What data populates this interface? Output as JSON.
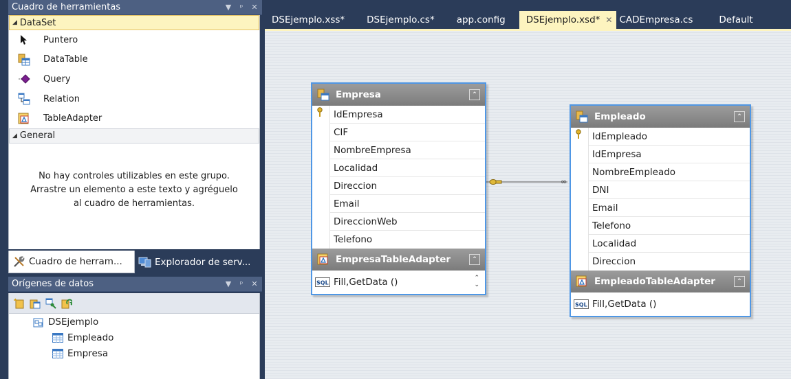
{
  "toolbox": {
    "title": "Cuadro de herramientas",
    "dataset_group": "DataSet",
    "items": [
      {
        "label": "Puntero"
      },
      {
        "label": "DataTable"
      },
      {
        "label": "Query"
      },
      {
        "label": "Relation"
      },
      {
        "label": "TableAdapter"
      }
    ],
    "general_group": "General",
    "empty_message_line1": "No hay controles utilizables en este grupo.",
    "empty_message_line2": "Arrastre un elemento a este texto y agréguelo",
    "empty_message_line3": "al cuadro de herramientas."
  },
  "bottom_tabs": {
    "toolbox": "Cuadro de herram...",
    "server_explorer": "Explorador de serv..."
  },
  "datasources": {
    "title": "Orígenes de datos",
    "root": "DSEjemplo",
    "tables": [
      "Empleado",
      "Empresa"
    ]
  },
  "doc_tabs": [
    {
      "label": "DSEjemplo.xss*"
    },
    {
      "label": "DSEjemplo.cs*"
    },
    {
      "label": "app.config"
    },
    {
      "label": "DSEjemplo.xsd*"
    },
    {
      "label": "CADEmpresa.cs"
    },
    {
      "label": "Default"
    }
  ],
  "designer": {
    "empresa": {
      "title": "Empresa",
      "columns": [
        "IdEmpresa",
        "CIF",
        "NombreEmpresa",
        "Localidad",
        "Direccion",
        "Email",
        "DireccionWeb",
        "Telefono"
      ],
      "adapter": "EmpresaTableAdapter",
      "method": "Fill,GetData ()"
    },
    "empleado": {
      "title": "Empleado",
      "columns": [
        "IdEmpleado",
        "IdEmpresa",
        "NombreEmpleado",
        "DNI",
        "Email",
        "Telefono",
        "Localidad",
        "Direccion"
      ],
      "adapter": "EmpleadoTableAdapter",
      "method": "Fill,GetData ()"
    }
  },
  "colors": {
    "chrome": "#2b3c59",
    "title_bar": "#4d6082",
    "active_tab": "#fdf4bf",
    "table_border": "#4f97e5",
    "table_header": "#8a8a8a"
  }
}
